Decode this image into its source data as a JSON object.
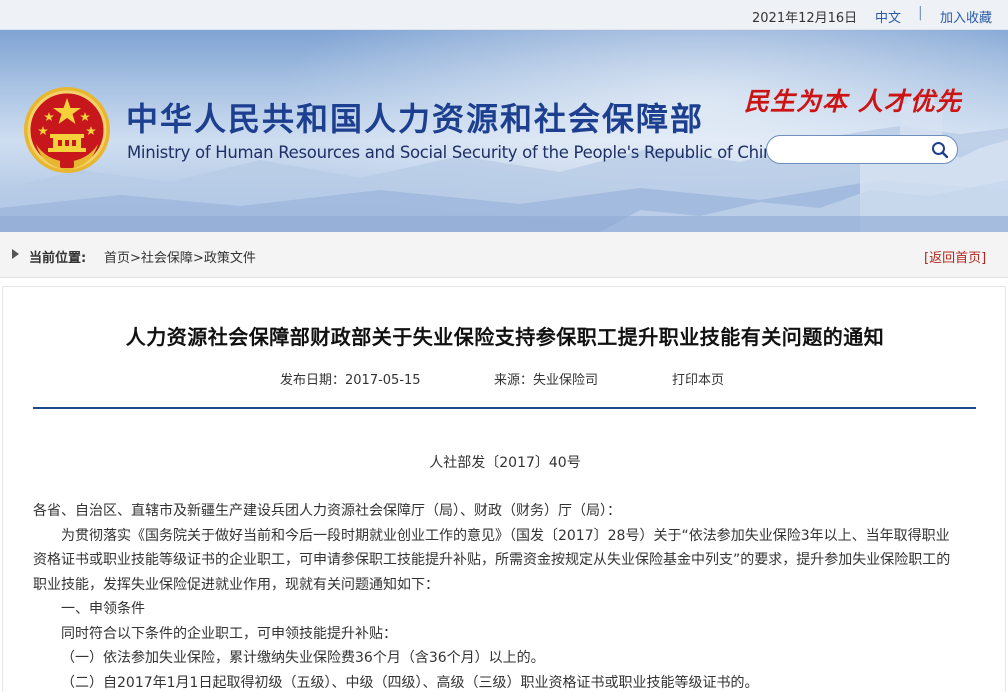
{
  "topbar": {
    "date": "2021年12月16日",
    "lang_link": "中文",
    "separator": "|",
    "favorite_link": "加入收藏"
  },
  "header": {
    "title_cn": "中华人民共和国人力资源和社会保障部",
    "title_en": "Ministry of Human Resources and Social Security of the People's Republic of China",
    "slogan": "民生为本 人才优先",
    "search_placeholder": "",
    "icons": {
      "emblem": "national-emblem",
      "search": "search-icon"
    }
  },
  "breadcrumb": {
    "label": "当前位置:",
    "items": [
      "首页",
      "社会保障",
      "政策文件"
    ],
    "separator": ">",
    "back_link": "[返回首页]"
  },
  "article": {
    "title": "人力资源社会保障部财政部关于失业保险支持参保职工提升职业技能有关问题的通知",
    "publish_date": "发布日期：2017-05-15",
    "source": "来源：失业保险司",
    "print_link": "打印本页",
    "doc_number": "人社部发〔2017〕40号",
    "paragraphs": [
      "各省、自治区、直辖市及新疆生产建设兵团人力资源社会保障厅（局）、财政（财务）厅（局）：",
      "为贯彻落实《国务院关于做好当前和今后一段时期就业创业工作的意见》（国发〔2017〕28号）关于“依法参加失业保险3年以上、当年取得职业资格证书或职业技能等级证书的企业职工，可申请参保职工技能提升补贴，所需资金按规定从失业保险基金中列支”的要求，提升参加失业保险职工的职业技能，发挥失业保险促进就业作用，现就有关问题通知如下：",
      "一、申领条件",
      "同时符合以下条件的企业职工，可申领技能提升补贴：",
      "（一）依法参加失业保险，累计缴纳失业保险费36个月（含36个月）以上的。",
      "（二）自2017年1月1日起取得初级（五级）、中级（四级）、高级（三级）职业资格证书或职业技能等级证书的。"
    ]
  },
  "colors": {
    "brand_blue": "#1d3f8f",
    "slogan_red": "#cc1414",
    "rule_blue": "#1e4a8a",
    "link_blue": "#2a5aa8",
    "back_red": "#b3261e"
  }
}
